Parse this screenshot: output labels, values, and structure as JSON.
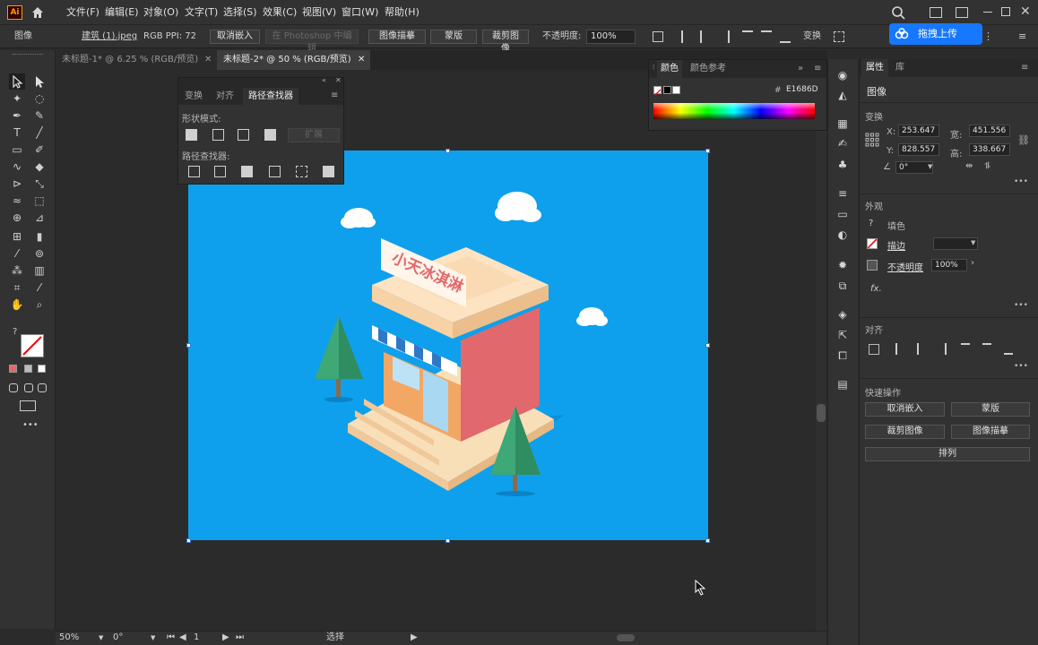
{
  "app": {
    "logo": "Ai"
  },
  "menu": [
    "文件(F)",
    "编辑(E)",
    "对象(O)",
    "文字(T)",
    "选择(S)",
    "效果(C)",
    "视图(V)",
    "窗口(W)",
    "帮助(H)"
  ],
  "control": {
    "kind": "图像",
    "filename": "建筑 (1).jpeg",
    "meta": "RGB  PPI: 72",
    "unembed": "取消嵌入",
    "photoshop": "在 Photoshop 中编辑",
    "trace": "图像描摹",
    "mask": "蒙版",
    "crop": "裁剪图像",
    "opacity_label": "不透明度:",
    "opacity": "100%",
    "transform": "变换"
  },
  "upload": {
    "label": "拖拽上传"
  },
  "tabs": [
    {
      "label": "未标题-1* @ 6.25 % (RGB/预览)",
      "active": false
    },
    {
      "label": "未标题-2* @ 50 % (RGB/预览)",
      "active": true
    }
  ],
  "pathfinder": {
    "tabs": [
      "变换",
      "对齐",
      "路径查找器"
    ],
    "shape_modes": "形状模式:",
    "expand": "扩展",
    "finders": "路径查找器:"
  },
  "color_panel": {
    "tabs": [
      "颜色",
      "颜色参考"
    ],
    "hex": "E1686D"
  },
  "artwork": {
    "sign": "小天冰淇淋"
  },
  "props": {
    "tabs": [
      "属性",
      "库"
    ],
    "kind": "图像",
    "transform": "变换",
    "x": "253.647",
    "y": "828.557",
    "w": "451.556",
    "h": "338.667",
    "angle": "0°",
    "x_label": "X:",
    "y_label": "Y:",
    "w_label": "宽:",
    "h_label": "高:",
    "appearance": "外观",
    "fill": "填色",
    "stroke": "描边",
    "opacity_label": "不透明度",
    "opacity": "100%",
    "fx": "fx.",
    "align": "对齐",
    "quick": "快速操作",
    "q_unembed": "取消嵌入",
    "q_mask": "蒙版",
    "q_crop": "裁剪图像",
    "q_trace": "图像描摹",
    "q_arrange": "排列"
  },
  "status": {
    "zoom": "50%",
    "rotate": "0°",
    "page": "1",
    "tool": "选择"
  },
  "colors": {
    "artboard": "#0ea0ec",
    "accent": "#1677ff",
    "shop_red": "#e1686d"
  }
}
